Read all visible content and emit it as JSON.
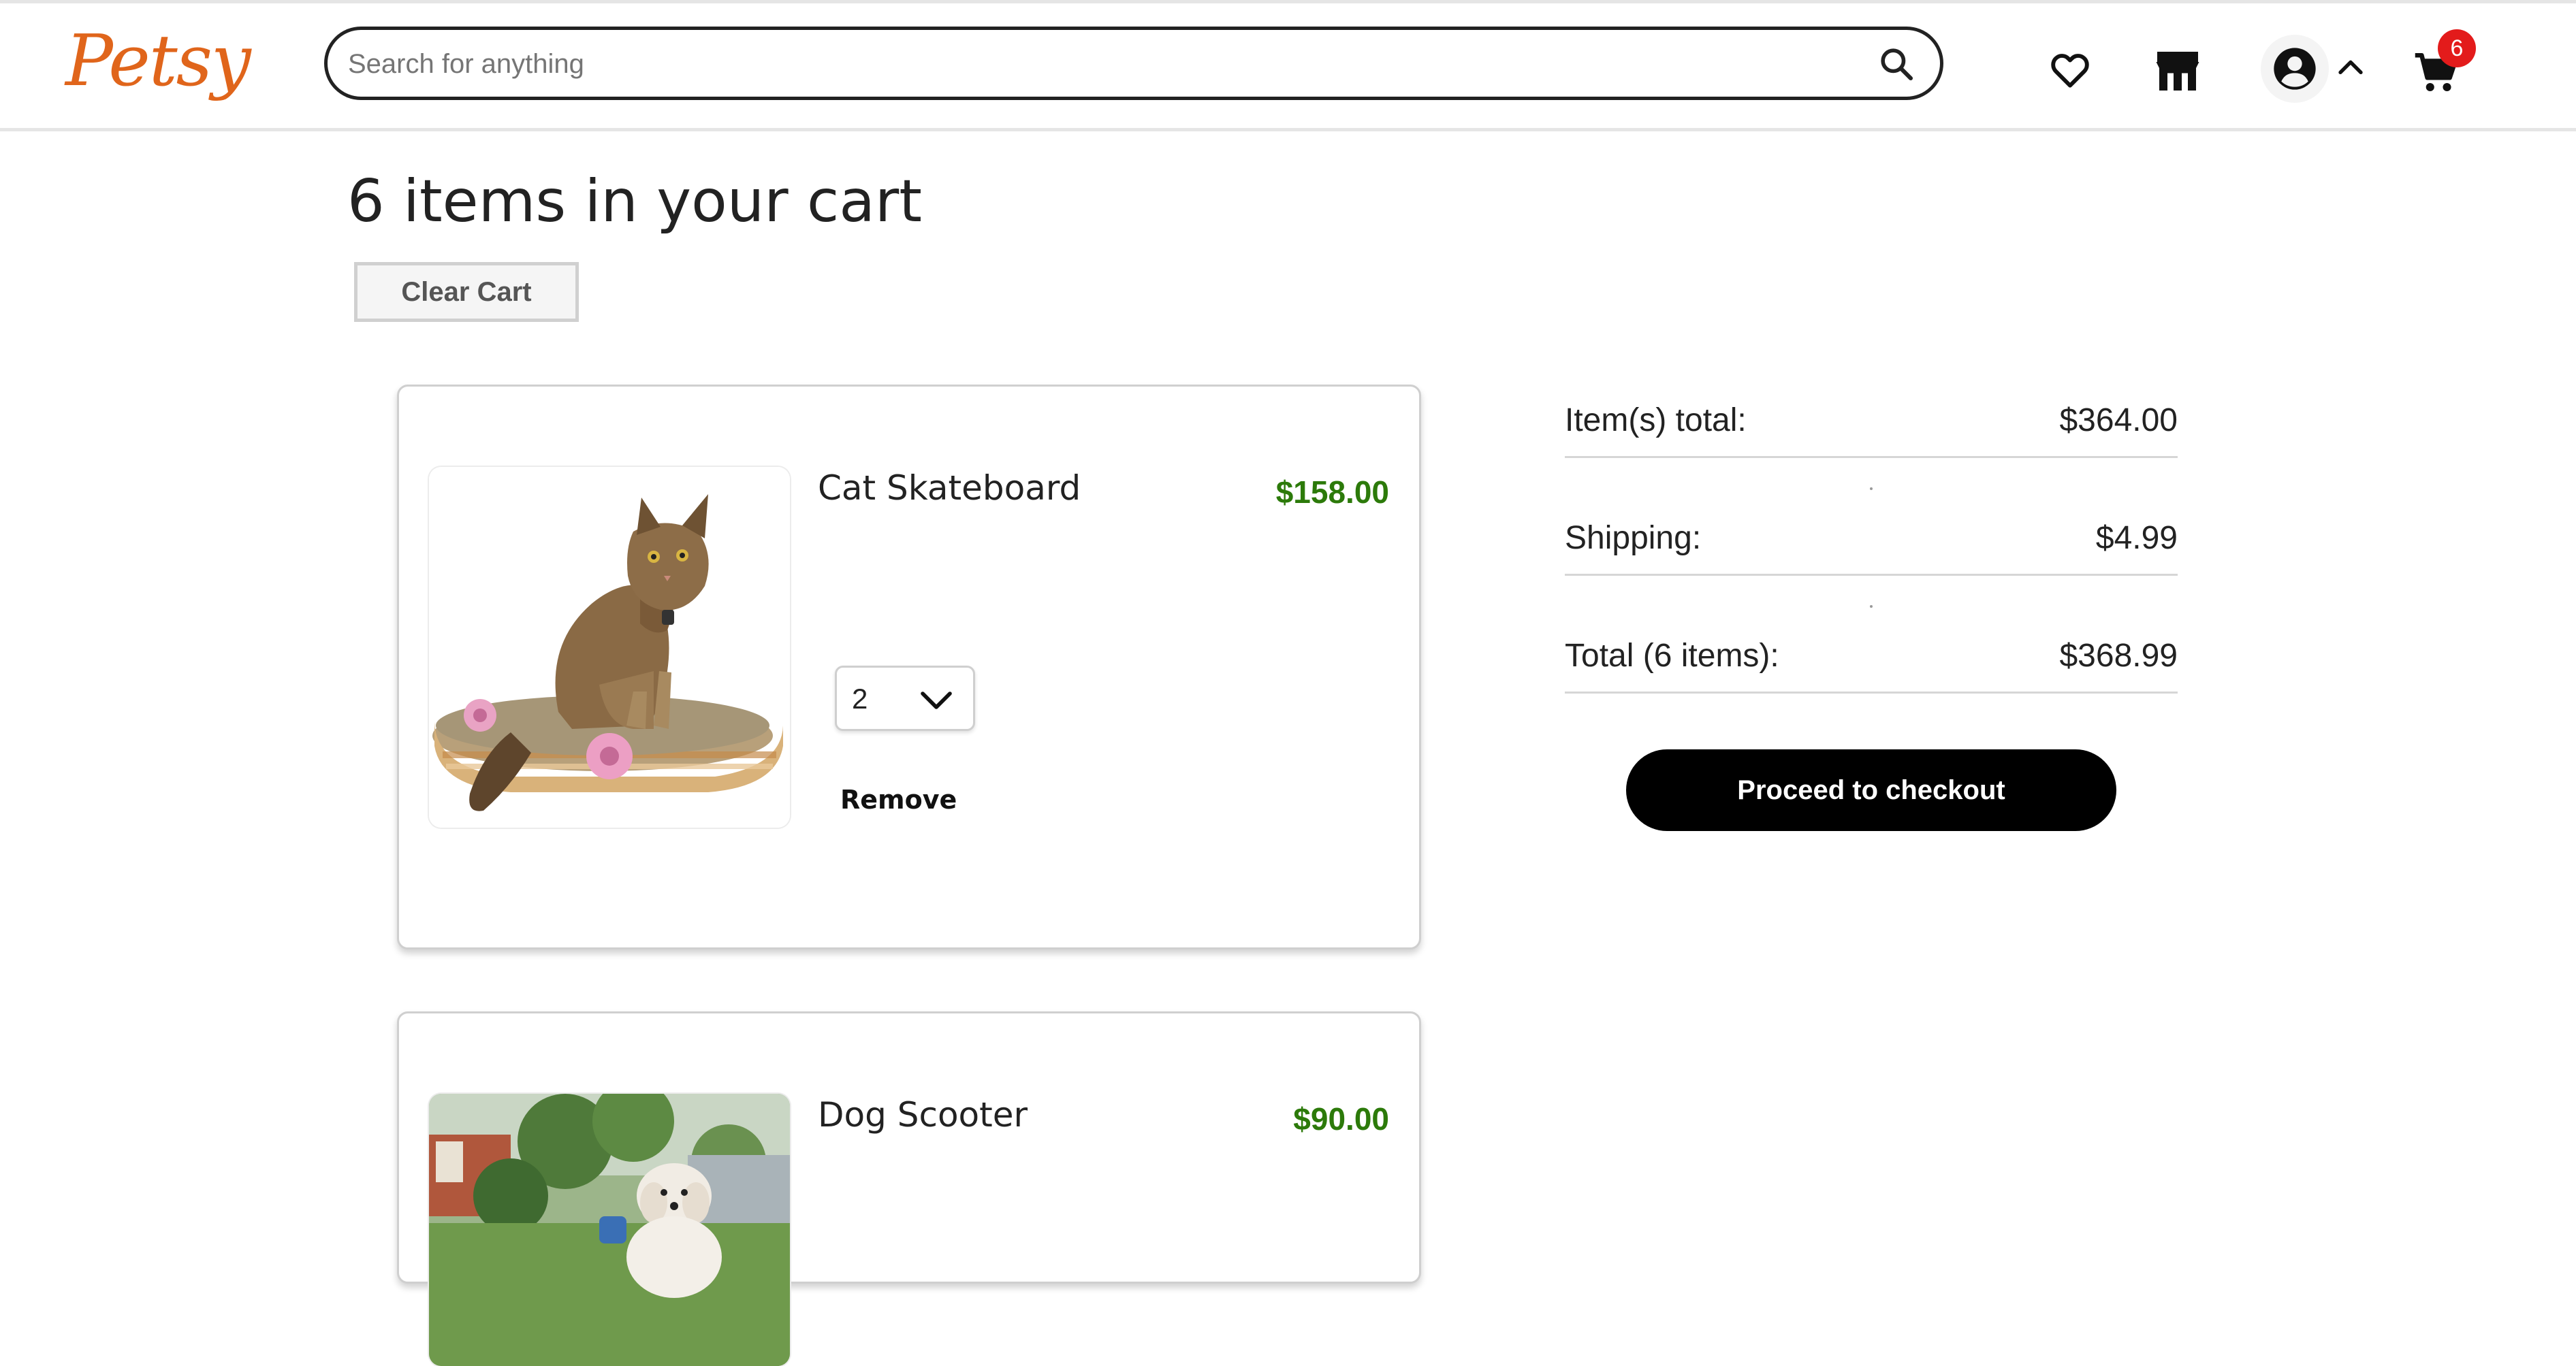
{
  "header": {
    "logo": "Petsy",
    "search": {
      "placeholder": "Search for anything",
      "value": ""
    },
    "icons": [
      "heart-icon",
      "store-icon",
      "user-icon",
      "chevron-up-icon",
      "cart-icon"
    ],
    "cart_count": "6"
  },
  "cart": {
    "title": "6 items in your cart",
    "clear_label": "Clear Cart",
    "items": [
      {
        "name": "Cat Skateboard",
        "price": "$158.00",
        "quantity": "2",
        "remove_label": "Remove",
        "image": "cat sitting on a skateboard"
      },
      {
        "name": "Dog Scooter",
        "price": "$90.00",
        "image": "small white dog outdoors"
      }
    ]
  },
  "summary": {
    "items_total_label": "Item(s) total:",
    "items_total_value": "$364.00",
    "shipping_label": "Shipping:",
    "shipping_value": "$4.99",
    "total_label": "Total (6 items):",
    "total_value": "$368.99",
    "checkout_label": "Proceed to checkout"
  },
  "colors": {
    "brand": "#e0651b",
    "price": "#2c7a0a",
    "badge": "#e31b1b",
    "checkout": "#000000"
  }
}
